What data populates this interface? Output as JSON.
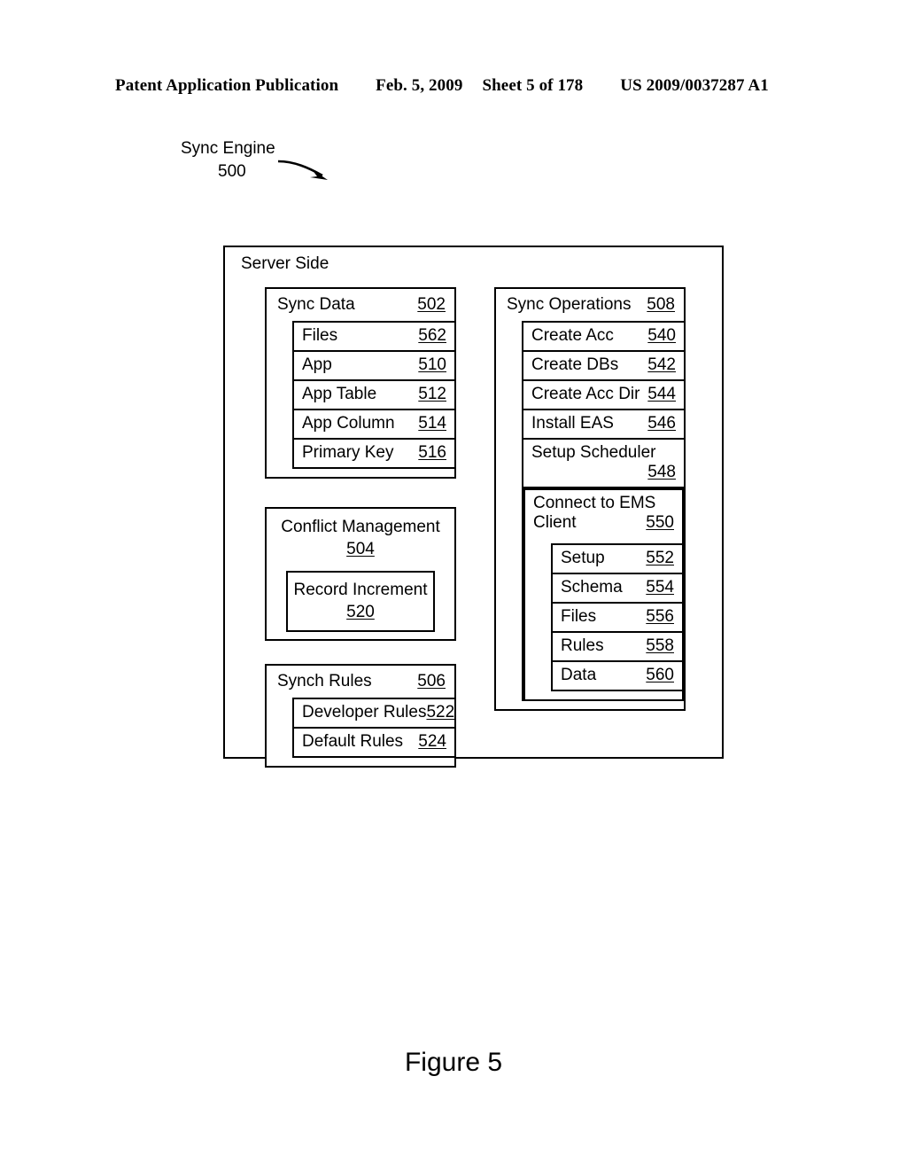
{
  "header": {
    "publication": "Patent Application Publication",
    "date": "Feb. 5, 2009",
    "sheet": "Sheet 5 of 178",
    "patent_number": "US 2009/0037287 A1"
  },
  "callout": {
    "title": "Sync Engine",
    "ref": "500",
    "arrow_icon": "curved-arrow-icon"
  },
  "diagram": {
    "outer_label": "Server Side",
    "left_column": [
      {
        "title": "Sync Data",
        "ref": "502",
        "rows": [
          {
            "label": "Files",
            "ref": "562"
          },
          {
            "label": "App",
            "ref": "510"
          },
          {
            "label": "App Table",
            "ref": "512"
          },
          {
            "label": "App Column",
            "ref": "514"
          },
          {
            "label": "Primary Key",
            "ref": "516"
          }
        ]
      },
      {
        "title": "Conflict Management",
        "ref": "504",
        "inner": {
          "label": "Record Increment",
          "ref": "520"
        }
      },
      {
        "title": "Synch Rules",
        "ref": "506",
        "rows": [
          {
            "label": "Developer Rules",
            "ref": "522"
          },
          {
            "label": "Default Rules",
            "ref": "524"
          }
        ]
      }
    ],
    "right_column": {
      "title": "Sync Operations",
      "ref": "508",
      "rows": [
        {
          "label": "Create Acc",
          "ref": "540"
        },
        {
          "label": "Create DBs",
          "ref": "542"
        },
        {
          "label": "Create Acc Dir",
          "ref": "544"
        },
        {
          "label": "Install EAS",
          "ref": "546"
        },
        {
          "label": "Setup Scheduler",
          "ref": "548"
        }
      ],
      "ems": {
        "label_line1": "Connect to EMS",
        "label_line2": "Client",
        "ref": "550",
        "rows": [
          {
            "label": "Setup",
            "ref": "552"
          },
          {
            "label": "Schema",
            "ref": "554"
          },
          {
            "label": "Files",
            "ref": "556"
          },
          {
            "label": "Rules",
            "ref": "558"
          },
          {
            "label": "Data",
            "ref": "560"
          }
        ]
      }
    }
  },
  "figure_caption": "Figure 5"
}
